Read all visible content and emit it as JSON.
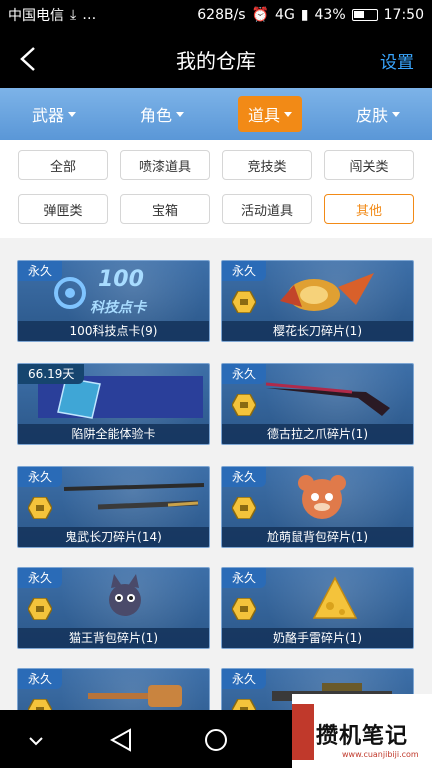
{
  "status_bar": {
    "carrier": "中国电信",
    "speed": "628B/s",
    "network": "4G",
    "battery": "43%",
    "time": "17:50"
  },
  "header": {
    "title": "我的仓库",
    "settings_label": "设置"
  },
  "categories": [
    {
      "label": "武器",
      "active": false
    },
    {
      "label": "角色",
      "active": false
    },
    {
      "label": "道具",
      "active": true
    },
    {
      "label": "皮肤",
      "active": false
    }
  ],
  "filters": [
    {
      "label": "全部",
      "active": false
    },
    {
      "label": "喷漆道具",
      "active": false
    },
    {
      "label": "竞技类",
      "active": false
    },
    {
      "label": "闯关类",
      "active": false
    },
    {
      "label": "弹匣类",
      "active": false
    },
    {
      "label": "宝箱",
      "active": false
    },
    {
      "label": "活动道具",
      "active": false
    },
    {
      "label": "其他",
      "active": true
    }
  ],
  "items": [
    {
      "badge": "永久",
      "label": "100科技点卡(9)",
      "art_text": "100",
      "art_sub": "科技点卡"
    },
    {
      "badge": "永久",
      "label": "樱花长刀碎片(1)"
    },
    {
      "badge": "66.19天",
      "label": "陷阱全能体验卡"
    },
    {
      "badge": "永久",
      "label": "德古拉之爪碎片(1)"
    },
    {
      "badge": "永久",
      "label": "鬼武长刀碎片(14)"
    },
    {
      "badge": "永久",
      "label": "尬萌鼠背包碎片(1)"
    },
    {
      "badge": "永久",
      "label": "猫王背包碎片(1)"
    },
    {
      "badge": "永久",
      "label": "奶酪手雷碎片(1)"
    },
    {
      "badge": "永久",
      "label": ""
    },
    {
      "badge": "永久",
      "label": ""
    }
  ],
  "watermark": {
    "text": "攒机笔记",
    "url": "www.cuanjibiji.com"
  },
  "colors": {
    "accent": "#f28a16",
    "header_bg": "#000000",
    "settings": "#3aa7ff",
    "card_bg": "#2b5789"
  }
}
